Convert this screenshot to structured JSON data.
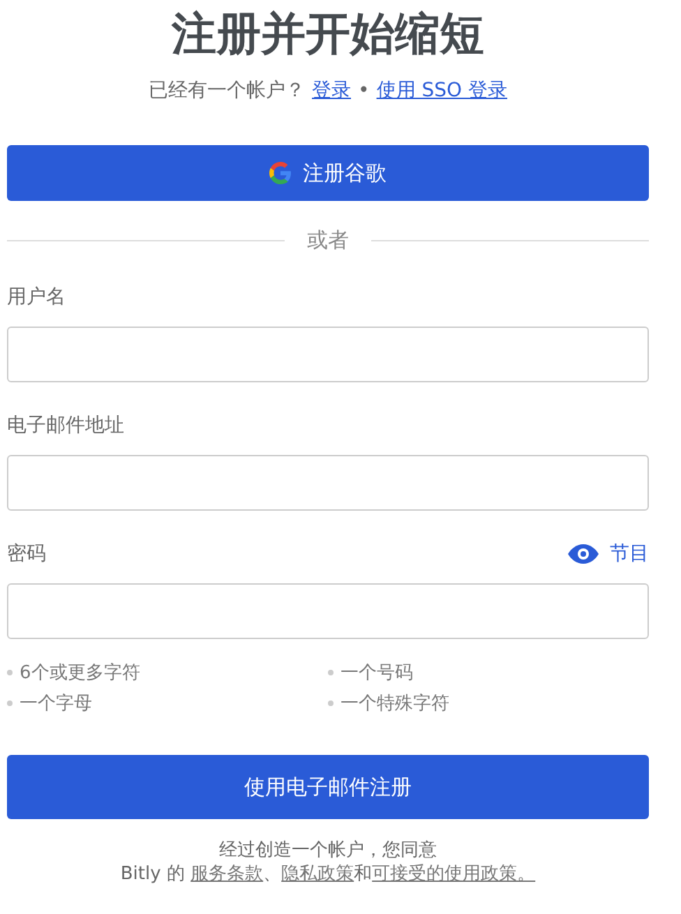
{
  "title": "注册并开始缩短",
  "login_prompt": {
    "text": "已经有一个帐户？",
    "links": [
      "登录",
      "使用 SSO 登录"
    ],
    "separator": "•"
  },
  "google_button": {
    "label": "注册谷歌"
  },
  "divider": "或者",
  "fields": [
    {
      "label": "用户名"
    },
    {
      "label": "电子邮件地址"
    },
    {
      "label": "密码",
      "toggle": "节目"
    }
  ],
  "requirements": [
    "6个或更多字符",
    "一个号码",
    "一个字母",
    "一个特殊字符"
  ],
  "submit_button": "使用电子邮件注册",
  "terms": {
    "line1": "经过创造一个帐户，您同意",
    "prefix": "Bitly 的 ",
    "links": [
      "服务条款",
      "隐私政策",
      "可接受的使用政策。"
    ],
    "joiners": [
      "、",
      "和"
    ]
  }
}
